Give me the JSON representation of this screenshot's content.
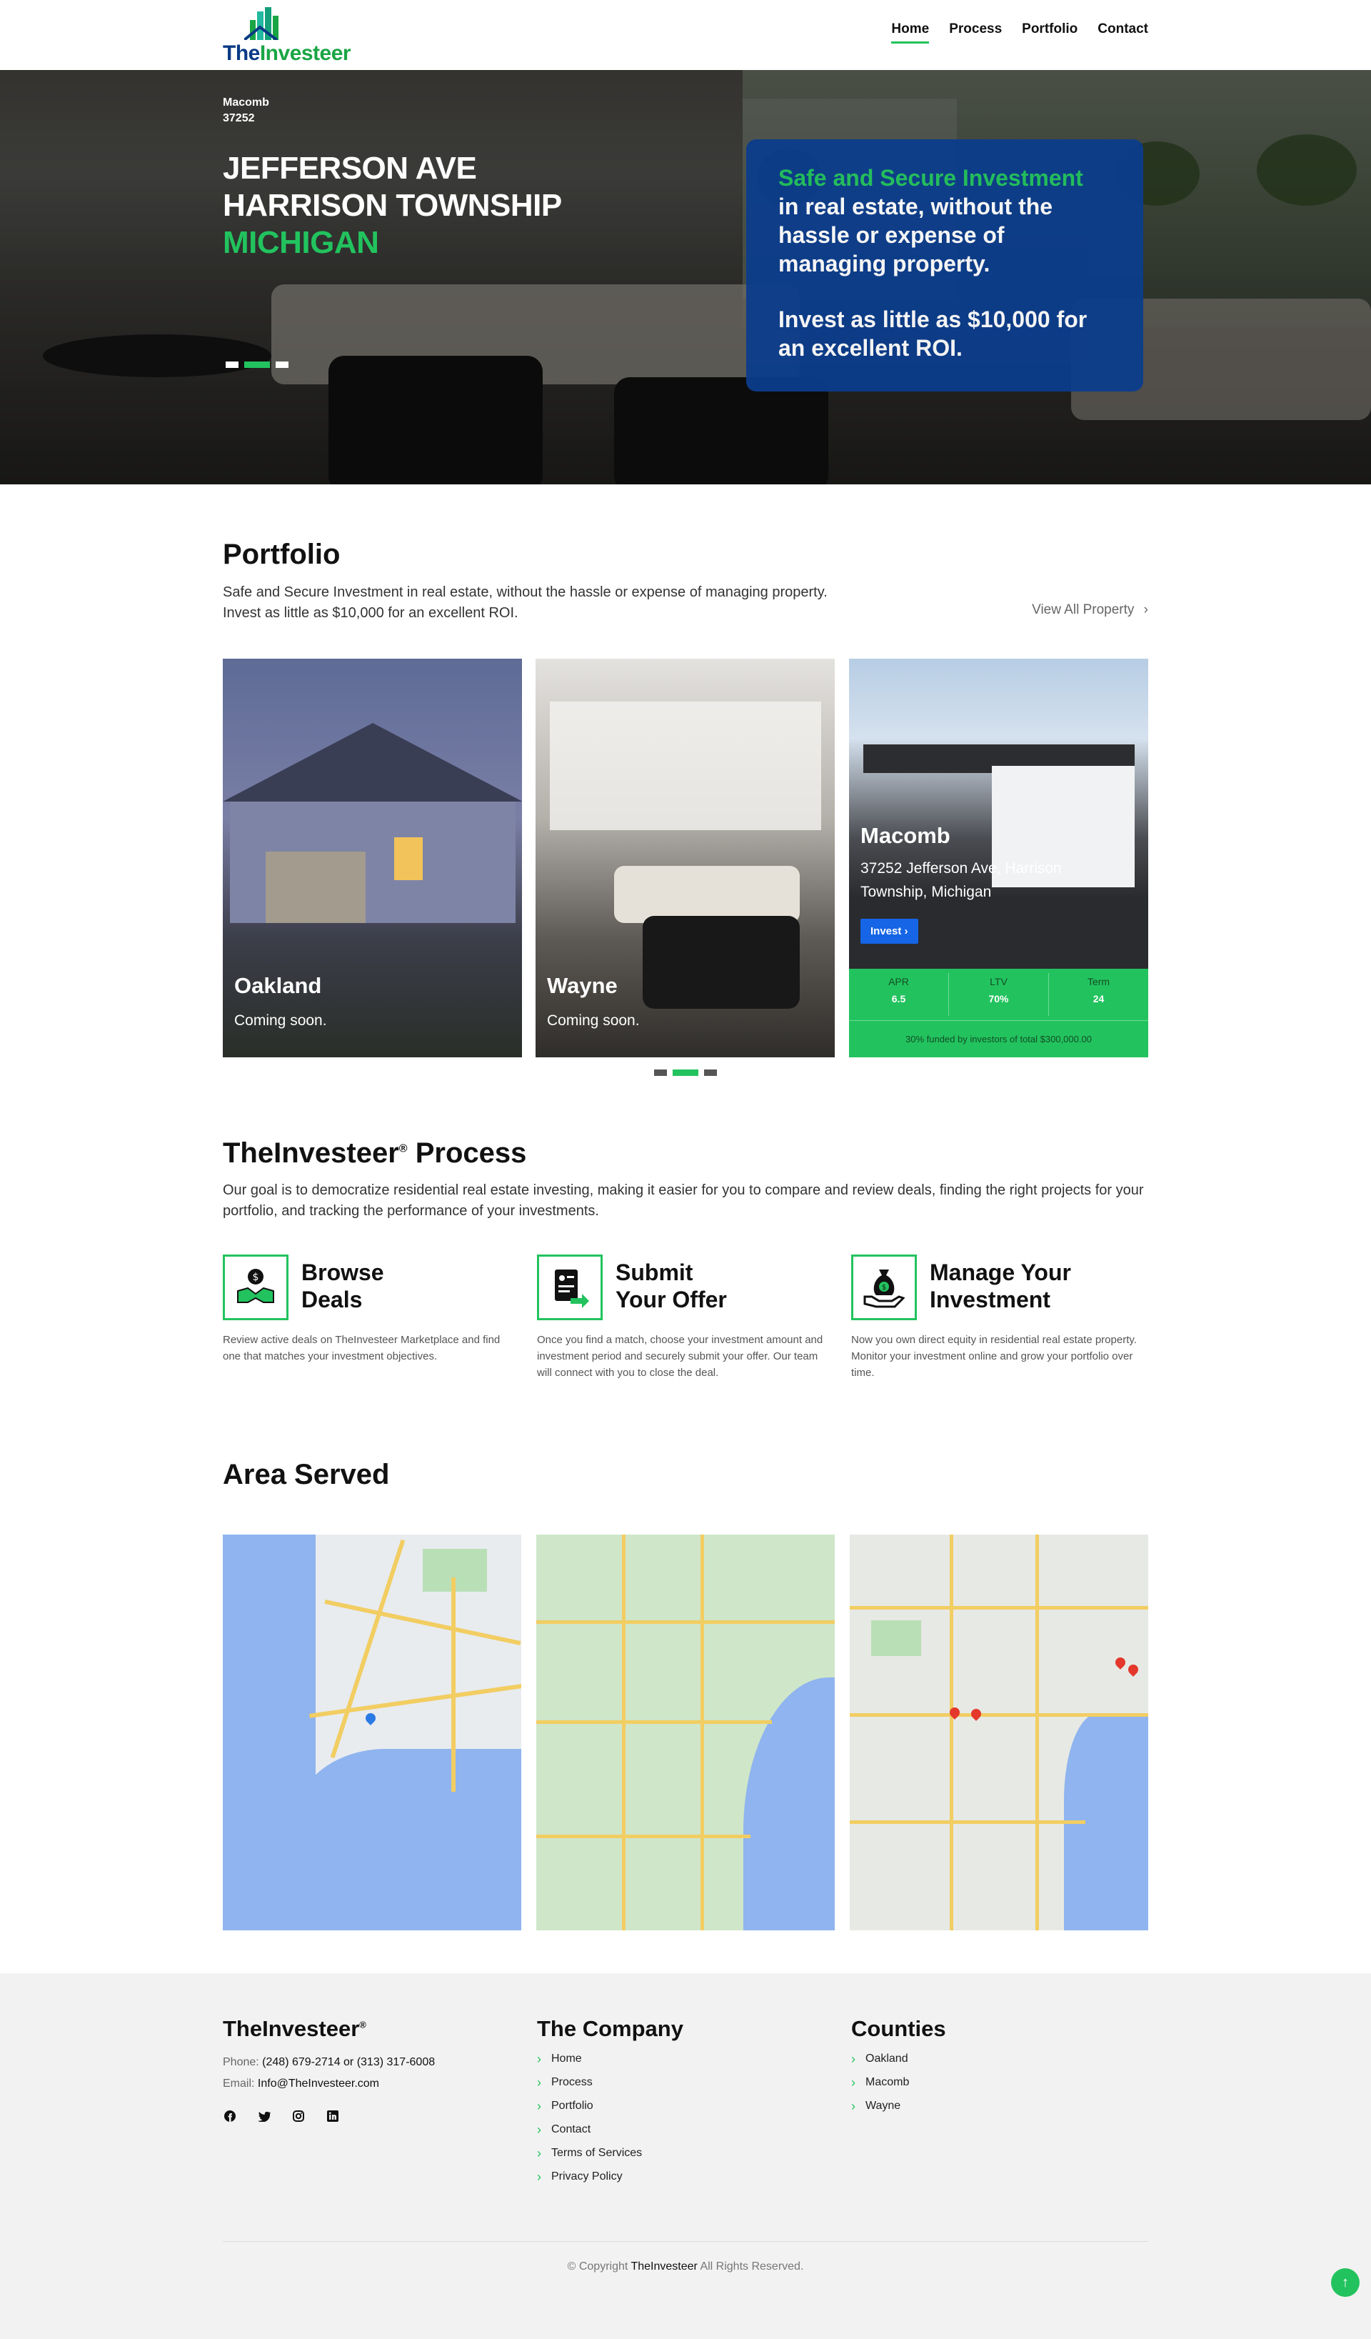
{
  "header": {
    "logo": {
      "part1": "The",
      "part2": "Investeer"
    },
    "nav": [
      {
        "label": "Home",
        "active": true
      },
      {
        "label": "Process",
        "active": false
      },
      {
        "label": "Portfolio",
        "active": false
      },
      {
        "label": "Contact",
        "active": false
      }
    ]
  },
  "hero": {
    "tag_line1": "Macomb",
    "tag_line2": "37252",
    "title_line1": "JEFFERSON AVE",
    "title_line2": "HARRISON TOWNSHIP",
    "title_line3": "MICHIGAN",
    "card_highlight": "Safe and Secure Investment",
    "card_text1": "in real estate, without the hassle or expense of managing property.",
    "card_text2": "Invest as little as $10,000 for an excellent ROI.",
    "slider_active_index": 1
  },
  "portfolio": {
    "title": "Portfolio",
    "subtitle_line1": "Safe and Secure Investment in real estate, without the hassle or expense of managing property.",
    "subtitle_line2": "Invest as little as $10,000 for an excellent ROI.",
    "view_all": "View All Property",
    "cards": [
      {
        "title": "Oakland",
        "subtitle": "Coming soon."
      },
      {
        "title": "Wayne",
        "subtitle": "Coming soon."
      },
      {
        "title": "Macomb",
        "address": "37252 Jefferson Ave, Harrison Township, Michigan",
        "button": "Invest",
        "stats": [
          {
            "label": "APR",
            "value": "6.5"
          },
          {
            "label": "LTV",
            "value": "70%"
          },
          {
            "label": "Term",
            "value": "24"
          }
        ],
        "funded": "30% funded by investors of total $300,000.00"
      }
    ]
  },
  "process": {
    "title": "TheInvesteer",
    "title_mark": "®",
    "title_suffix": " Process",
    "subtitle": "Our goal is to democratize residential real estate investing, making it easier for you to compare and review deals, finding the right projects for your portfolio, and tracking the performance of your investments.",
    "steps": [
      {
        "title_line1": "Browse",
        "title_line2": "Deals",
        "icon": "handshake-money-icon",
        "text": "Review active deals on TheInvesteer Marketplace and find one that matches your investment objectives."
      },
      {
        "title_line1": "Submit",
        "title_line2": "Your Offer",
        "icon": "submit-offer-icon",
        "text": "Once you find a match, choose your investment amount and investment period and securely submit your offer. Our team will connect with you to close the deal."
      },
      {
        "title_line1": "Manage Your",
        "title_line2": "Investment",
        "icon": "money-bag-hand-icon",
        "text": "Now you own direct equity in residential real estate property. Monitor your investment online and grow your portfolio over time."
      }
    ]
  },
  "area": {
    "title": "Area Served",
    "maps": [
      "oakland-map",
      "macomb-map",
      "wayne-map"
    ]
  },
  "footer": {
    "brand": "TheInvesteer",
    "brand_mark": "®",
    "phone_label": "Phone:",
    "phone": "(248) 679-2714 or (313) 317-6008",
    "email_label": "Email:",
    "email": "Info@TheInvesteer.com",
    "socials": [
      "facebook-icon",
      "twitter-icon",
      "instagram-icon",
      "linkedin-icon"
    ],
    "company_title": "The Company",
    "company_links": [
      "Home",
      "Process",
      "Portfolio",
      "Contact",
      "Terms of Services",
      "Privacy Policy"
    ],
    "counties_title": "Counties",
    "counties": [
      "Oakland",
      "Macomb",
      "Wayne"
    ],
    "copyright_prefix": "© Copyright",
    "copyright_brand": "TheInvesteer",
    "copyright_suffix": "All Rights Reserved."
  },
  "colors": {
    "accent": "#22c35e",
    "brand_blue": "#0c3d8c",
    "button_blue": "#1565e6"
  }
}
